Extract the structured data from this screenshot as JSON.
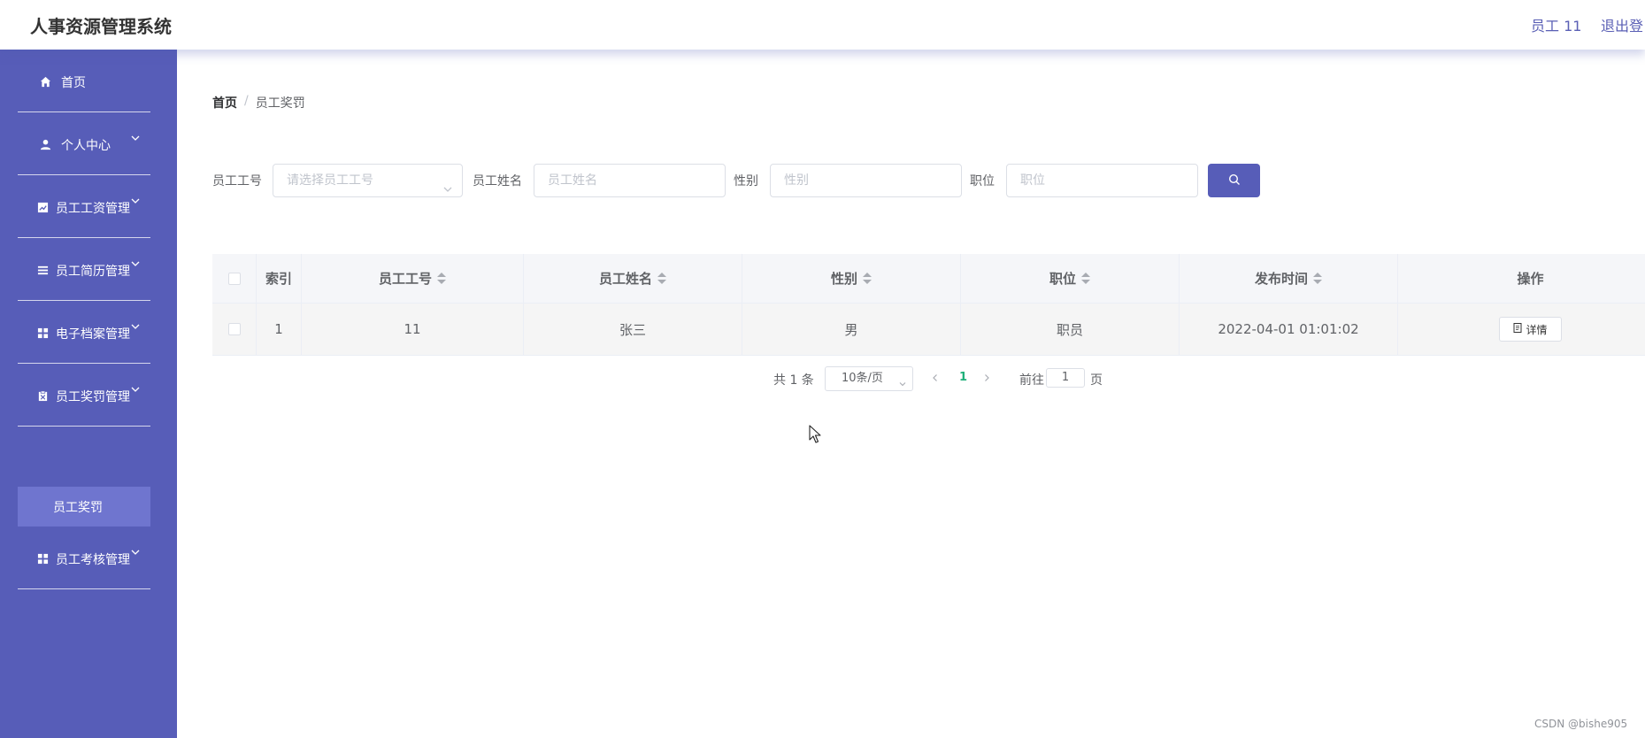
{
  "header": {
    "app_title": "人事资源管理系统",
    "user_label": "员工 11",
    "logout_label": "退出登"
  },
  "sidebar": {
    "items": [
      {
        "label": "首页",
        "icon": "home-icon"
      },
      {
        "label": "个人中心",
        "icon": "user-icon"
      },
      {
        "label": "员工工资管理",
        "icon": "chart-icon"
      },
      {
        "label": "员工简历管理",
        "icon": "list-icon"
      },
      {
        "label": "电子档案管理",
        "icon": "grid-icon"
      },
      {
        "label": "员工奖罚管理",
        "icon": "clipboard-icon"
      },
      {
        "label": "员工考核管理",
        "icon": "grid-icon"
      }
    ],
    "active_sub_item": "员工奖罚"
  },
  "breadcrumb": {
    "home": "首页",
    "separator": "/",
    "current": "员工奖罚"
  },
  "filters": {
    "employee_no_label": "员工工号",
    "employee_no_placeholder": "请选择员工工号",
    "employee_name_label": "员工姓名",
    "employee_name_placeholder": "员工姓名",
    "gender_label": "性别",
    "gender_placeholder": "性别",
    "position_label": "职位",
    "position_placeholder": "职位"
  },
  "table": {
    "headers": [
      "索引",
      "员工工号",
      "员工姓名",
      "性别",
      "职位",
      "发布时间",
      "操作"
    ],
    "rows": [
      {
        "index": "1",
        "employee_no": "11",
        "name": "张三",
        "gender": "男",
        "position": "职员",
        "publish_time": "2022-04-01 01:01:02",
        "action": "详情"
      }
    ]
  },
  "pagination": {
    "total_text": "共 1 条",
    "page_size": "10条/页",
    "current_page": "1",
    "goto_label": "前往",
    "goto_value": "1",
    "page_suffix": "页"
  },
  "watermark": "CSDN @bishe905",
  "colors": {
    "primary": "#575db8",
    "active_sub": "#6f75cf",
    "page_active": "#1fb07a"
  }
}
